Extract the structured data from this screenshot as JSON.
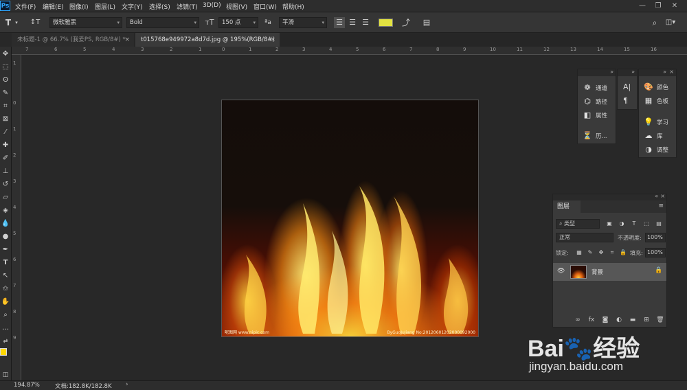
{
  "app": {
    "logo": "Ps"
  },
  "menu": [
    "文件(F)",
    "编辑(E)",
    "图像(I)",
    "图层(L)",
    "文字(Y)",
    "选择(S)",
    "滤镜(T)",
    "3D(D)",
    "视图(V)",
    "窗口(W)",
    "帮助(H)"
  ],
  "window_controls": {
    "minimize": "—",
    "restore": "❐",
    "close": "✕"
  },
  "options": {
    "font_family": "微软雅黑",
    "font_style": "Bold",
    "font_size": "150 点",
    "antialias_label": "ªa",
    "antialias": "平滑",
    "text_color": "#e3e341"
  },
  "tabs": [
    {
      "label": "未标题-1 @ 66.7% (我爱PS, RGB/8#) *",
      "close": "×"
    },
    {
      "label": "t015768e949972a8d7d.jpg @ 195%(RGB/8#)",
      "close": "×"
    }
  ],
  "ruler_top": [
    "7",
    "6",
    "5",
    "4",
    "3",
    "2",
    "1",
    "0",
    "1",
    "2",
    "3",
    "4",
    "5",
    "6",
    "7",
    "8",
    "9",
    "10",
    "11",
    "12",
    "13",
    "14",
    "15",
    "16"
  ],
  "ruler_left": [
    "1",
    "0",
    "1",
    "2",
    "3",
    "4",
    "5",
    "6",
    "7",
    "8",
    "9"
  ],
  "image": {
    "watermark_left": "昵图网 www.nipic.com",
    "watermark_right": "ByGuoJuJiang No:20120601202000092000"
  },
  "panels": {
    "dock1": [
      "通道",
      "路径",
      "属性",
      "历..."
    ],
    "dock2_icons": [
      "A|",
      "¶"
    ],
    "dock3_top": [
      "颜色",
      "色板"
    ],
    "dock3_bottom": [
      "学习",
      "库",
      "调整"
    ]
  },
  "layers": {
    "tab": "图层",
    "filter_kind": "类型",
    "blend_mode": "正常",
    "opacity_label": "不透明度:",
    "opacity": "100%",
    "lock_label": "锁定:",
    "fill_label": "填充:",
    "fill": "100%",
    "layer_name": "背景"
  },
  "status": {
    "zoom": "194.87%",
    "doc_info": "文档:182.8K/182.8K",
    "arrow": "›"
  },
  "watermark": {
    "brand": "Bai🐾经验",
    "url": "jingyan.baidu.com"
  }
}
